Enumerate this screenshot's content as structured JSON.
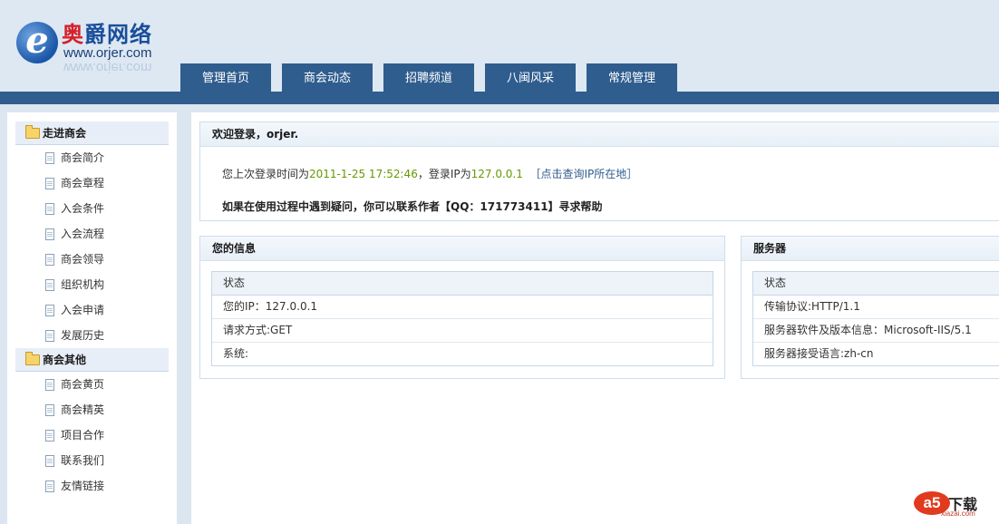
{
  "logo": {
    "cn_red": "奥",
    "cn_rest": "爵网络",
    "url": "www.orjer.com",
    "e_letter": "e"
  },
  "nav": {
    "tabs": [
      "管理首页",
      "商会动态",
      "招聘频道",
      "八闽风采",
      "常规管理"
    ]
  },
  "sidebar": {
    "groups": [
      {
        "title": "走进商会",
        "items": [
          "商会简介",
          "商会章程",
          "入会条件",
          "入会流程",
          "商会领导",
          "组织机构",
          "入会申请",
          "发展历史"
        ]
      },
      {
        "title": "商会其他",
        "items": [
          "商会黄页",
          "商会精英",
          "项目合作",
          "联系我们",
          "友情链接"
        ]
      }
    ]
  },
  "welcome": {
    "title": "欢迎登录，orjer.",
    "last_login_prefix": "您上次登录时间为",
    "last_login_time": "2011-1-25 17:52:46",
    "ip_prefix": "，登录IP为",
    "ip": "127.0.0.1",
    "query_link": "［点击查询IP所在地］",
    "help_text": "如果在使用过程中遇到疑问，你可以联系作者【QQ：171773411】寻求帮助"
  },
  "info_panel": {
    "title": "您的信息",
    "header": "状态",
    "rows": [
      "您的IP：127.0.0.1",
      "请求方式:GET",
      "系统:"
    ]
  },
  "server_panel": {
    "title": "服务器",
    "header": "状态",
    "rows": [
      "传输协议:HTTP/1.1",
      "服务器软件及版本信息：Microsoft-IIS/5.1",
      "服务器接受语言:zh-cn"
    ]
  },
  "watermark": {
    "badge": "a5",
    "text": "下载",
    "sub": "xiazai.com"
  },
  "colors": {
    "nav_blue": "#2f5d8e",
    "background": "#dbe6f1",
    "highlight_green": "#669900"
  }
}
